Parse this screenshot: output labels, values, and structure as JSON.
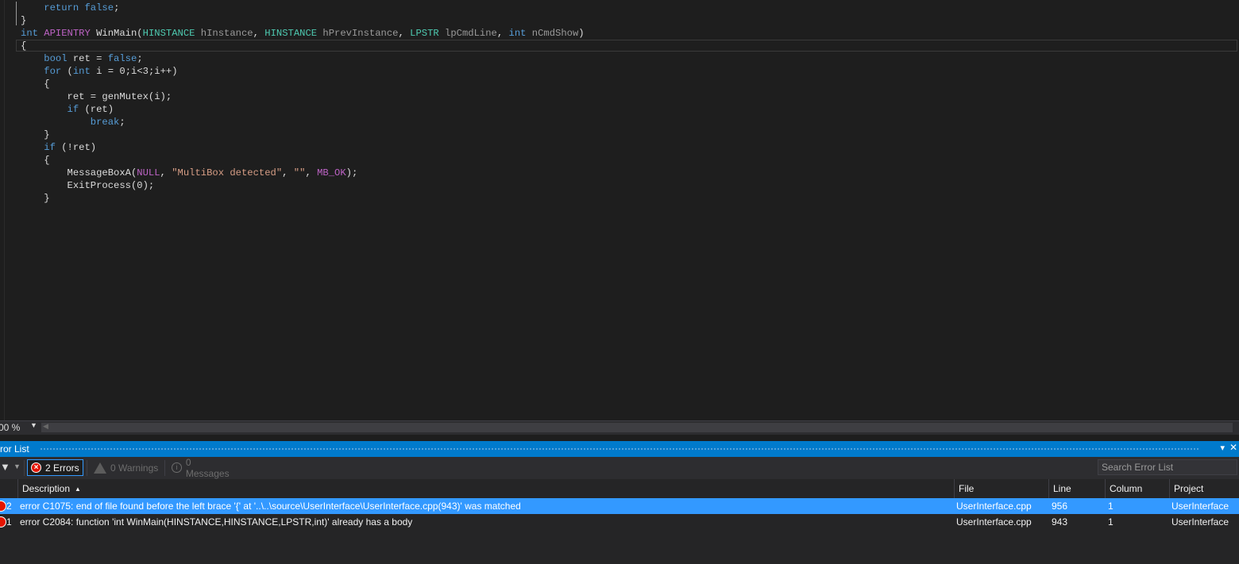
{
  "editor": {
    "lines": [
      [
        {
          "t": "    ",
          "c": "plain"
        },
        {
          "t": "return",
          "c": "kw"
        },
        {
          "t": " ",
          "c": "plain"
        },
        {
          "t": "false",
          "c": "kw"
        },
        {
          "t": ";",
          "c": "plain"
        }
      ],
      [
        {
          "t": "}",
          "c": "plain"
        }
      ],
      [
        {
          "t": "int",
          "c": "kw"
        },
        {
          "t": " ",
          "c": "plain"
        },
        {
          "t": "APIENTRY",
          "c": "macro"
        },
        {
          "t": " WinMain(",
          "c": "plain"
        },
        {
          "t": "HINSTANCE",
          "c": "type"
        },
        {
          "t": " ",
          "c": "plain"
        },
        {
          "t": "hInstance",
          "c": "param"
        },
        {
          "t": ", ",
          "c": "plain"
        },
        {
          "t": "HINSTANCE",
          "c": "type"
        },
        {
          "t": " ",
          "c": "plain"
        },
        {
          "t": "hPrevInstance",
          "c": "param"
        },
        {
          "t": ", ",
          "c": "plain"
        },
        {
          "t": "LPSTR",
          "c": "type"
        },
        {
          "t": " ",
          "c": "plain"
        },
        {
          "t": "lpCmdLine",
          "c": "param"
        },
        {
          "t": ", ",
          "c": "plain"
        },
        {
          "t": "int",
          "c": "kw"
        },
        {
          "t": " ",
          "c": "plain"
        },
        {
          "t": "nCmdShow",
          "c": "param"
        },
        {
          "t": ")",
          "c": "plain"
        }
      ],
      [
        {
          "t": "{",
          "c": "plain"
        }
      ],
      [
        {
          "t": "    ",
          "c": "plain"
        },
        {
          "t": "bool",
          "c": "kw"
        },
        {
          "t": " ret = ",
          "c": "plain"
        },
        {
          "t": "false",
          "c": "kw"
        },
        {
          "t": ";",
          "c": "plain"
        }
      ],
      [
        {
          "t": "    ",
          "c": "plain"
        },
        {
          "t": "for",
          "c": "kw"
        },
        {
          "t": " (",
          "c": "plain"
        },
        {
          "t": "int",
          "c": "kw"
        },
        {
          "t": " i = 0;i<3;i++)",
          "c": "plain"
        }
      ],
      [
        {
          "t": "    {",
          "c": "plain"
        }
      ],
      [
        {
          "t": "        ret = genMutex(i);",
          "c": "plain"
        }
      ],
      [
        {
          "t": "        ",
          "c": "plain"
        },
        {
          "t": "if",
          "c": "kw"
        },
        {
          "t": " (ret)",
          "c": "plain"
        }
      ],
      [
        {
          "t": "            ",
          "c": "plain"
        },
        {
          "t": "break",
          "c": "kw"
        },
        {
          "t": ";",
          "c": "plain"
        }
      ],
      [
        {
          "t": "    }",
          "c": "plain"
        }
      ],
      [
        {
          "t": "    ",
          "c": "plain"
        },
        {
          "t": "if",
          "c": "kw"
        },
        {
          "t": " (!ret)",
          "c": "plain"
        }
      ],
      [
        {
          "t": "    {",
          "c": "plain"
        }
      ],
      [
        {
          "t": "        MessageBoxA(",
          "c": "plain"
        },
        {
          "t": "NULL",
          "c": "macro"
        },
        {
          "t": ", ",
          "c": "plain"
        },
        {
          "t": "\"MultiBox detected\"",
          "c": "str"
        },
        {
          "t": ", ",
          "c": "plain"
        },
        {
          "t": "\"\"",
          "c": "str"
        },
        {
          "t": ", ",
          "c": "plain"
        },
        {
          "t": "MB_OK",
          "c": "macro"
        },
        {
          "t": ");",
          "c": "plain"
        }
      ],
      [
        {
          "t": "        ExitProcess(0);",
          "c": "plain"
        }
      ],
      [
        {
          "t": "    }",
          "c": "plain"
        }
      ]
    ]
  },
  "zoom": {
    "value": "00 %",
    "dropdown_icon": "caret-down-icon"
  },
  "error_list": {
    "title": "rror List",
    "toolbar": {
      "errors_label": "2 Errors",
      "warnings_label": "0 Warnings",
      "messages_label": "0 Messages",
      "search_placeholder": "Search Error List"
    },
    "columns": {
      "description": "Description",
      "file": "File",
      "line": "Line",
      "column": "Column",
      "project": "Project"
    },
    "rows": [
      {
        "index": "2",
        "description": "error C1075: end of file found before the left brace '{' at '..\\..\\source\\UserInterface\\UserInterface.cpp(943)' was matched",
        "file": "UserInterface.cpp",
        "line": "956",
        "column": "1",
        "project": "UserInterface"
      },
      {
        "index": "1",
        "description": "error C2084: function 'int WinMain(HINSTANCE,HINSTANCE,LPSTR,int)' already has a body",
        "file": "UserInterface.cpp",
        "line": "943",
        "column": "1",
        "project": "UserInterface"
      }
    ]
  },
  "colors": {
    "accent": "#007acc",
    "selection": "#3399ff",
    "error": "#e51400",
    "background": "#1e1e1e"
  }
}
